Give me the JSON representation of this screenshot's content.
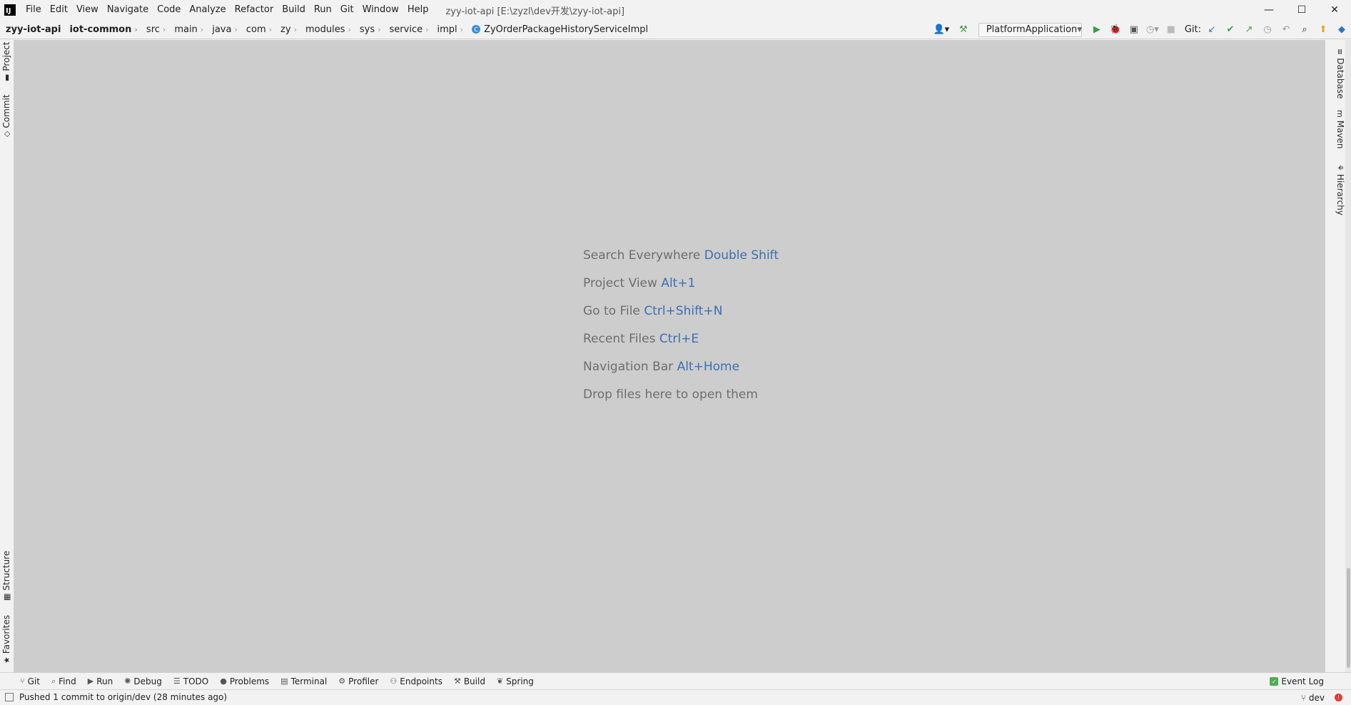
{
  "menu": {
    "items": [
      "File",
      "Edit",
      "View",
      "Navigate",
      "Code",
      "Analyze",
      "Refactor",
      "Build",
      "Run",
      "Git",
      "Window",
      "Help"
    ],
    "window_title": "zyy-iot-api [E:\\zyzl\\dev开发\\zyy-iot-api]"
  },
  "window_controls": {
    "minimize": "—",
    "maximize": "☐",
    "close": "✕"
  },
  "breadcrumbs": [
    "zyy-iot-api",
    "iot-common",
    "src",
    "main",
    "java",
    "com",
    "zy",
    "modules",
    "sys",
    "service",
    "impl",
    "ZyOrderPackageHistoryServiceImpl"
  ],
  "toolbar": {
    "run_config": "PlatformApplication",
    "git_label": "Git:"
  },
  "left_tabs": {
    "project": "Project",
    "commit": "Commit",
    "structure": "Structure",
    "favorites": "Favorites"
  },
  "right_tabs": {
    "database": "Database",
    "maven": "Maven",
    "hierarchy": "Hierarchy"
  },
  "hints": [
    {
      "text": "Search Everywhere",
      "key": "Double Shift"
    },
    {
      "text": "Project View",
      "key": "Alt+1"
    },
    {
      "text": "Go to File",
      "key": "Ctrl+Shift+N"
    },
    {
      "text": "Recent Files",
      "key": "Ctrl+E"
    },
    {
      "text": "Navigation Bar",
      "key": "Alt+Home"
    },
    {
      "text": "Drop files here to open them",
      "key": ""
    }
  ],
  "tool_windows": [
    "Git",
    "Find",
    "Run",
    "Debug",
    "TODO",
    "Problems",
    "Terminal",
    "Profiler",
    "Endpoints",
    "Build",
    "Spring"
  ],
  "event_log": "Event Log",
  "status": {
    "message": "Pushed 1 commit to origin/dev (28 minutes ago)",
    "branch": "dev"
  },
  "colors": {
    "editor_bg": "#cdcdcd",
    "hint_key": "#3d6fb0",
    "run_green": "#3b9c4a",
    "error_red": "#e53935"
  }
}
